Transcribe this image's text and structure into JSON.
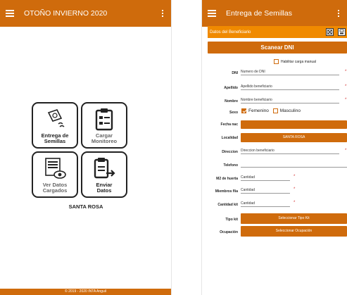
{
  "left": {
    "appbar_title": "OTOÑO INVIERNO 2020",
    "tiles": [
      {
        "line1": "Entrega de",
        "line2": "Semillas"
      },
      {
        "line1": "Cargar",
        "line2": "Monitoreo"
      },
      {
        "line1": "Ver Datos",
        "line2": "Cargados"
      },
      {
        "line1": "Enviar",
        "line2": "Datos"
      }
    ],
    "city": "SANTA ROSA",
    "footer": "© 2019 - 2020 INTA Anguil"
  },
  "right": {
    "appbar_title": "Entrega de Semillas",
    "section_title": "Datos del Beneficiario",
    "scan_button": "Scanear DNI",
    "manual_checkbox": "Habilitar carga manual",
    "dni_label": "DNI",
    "dni_value": "Numero de DNI",
    "apellido_label": "Apellido",
    "apellido_value": "Apellido beneficiario",
    "nombre_label": "Nombre",
    "nombre_value": "Nombre beneficiario",
    "sexo_label": "Sexo",
    "femenino": "Femenino",
    "masculino": "Masculino",
    "fecha_label": "Fecha nac",
    "localidad_label": "Localidad",
    "localidad_value": "SANTA ROSA",
    "direccion_label": "Direccion",
    "direccion_value": "Direccion beneficiario",
    "telefono_label": "Telefono",
    "m2_label": "M2 de huerta",
    "m2_value": "Cantidad",
    "miembros_label": "Miembros flia",
    "miembros_value": "Cantidad",
    "kit_label": "Cantidad kit",
    "kit_value": "Cantidad",
    "tipokit_label": "Tipo kit",
    "tipokit_button": "Seleccionar Tipo Kit",
    "ocupacion_label": "Ocupación",
    "ocupacion_button": "Seleccionar Ocupación",
    "required_mark": "*"
  },
  "colors": {
    "primary": "#cf6b0c",
    "section": "#f08a00",
    "required": "#d32f2f"
  }
}
